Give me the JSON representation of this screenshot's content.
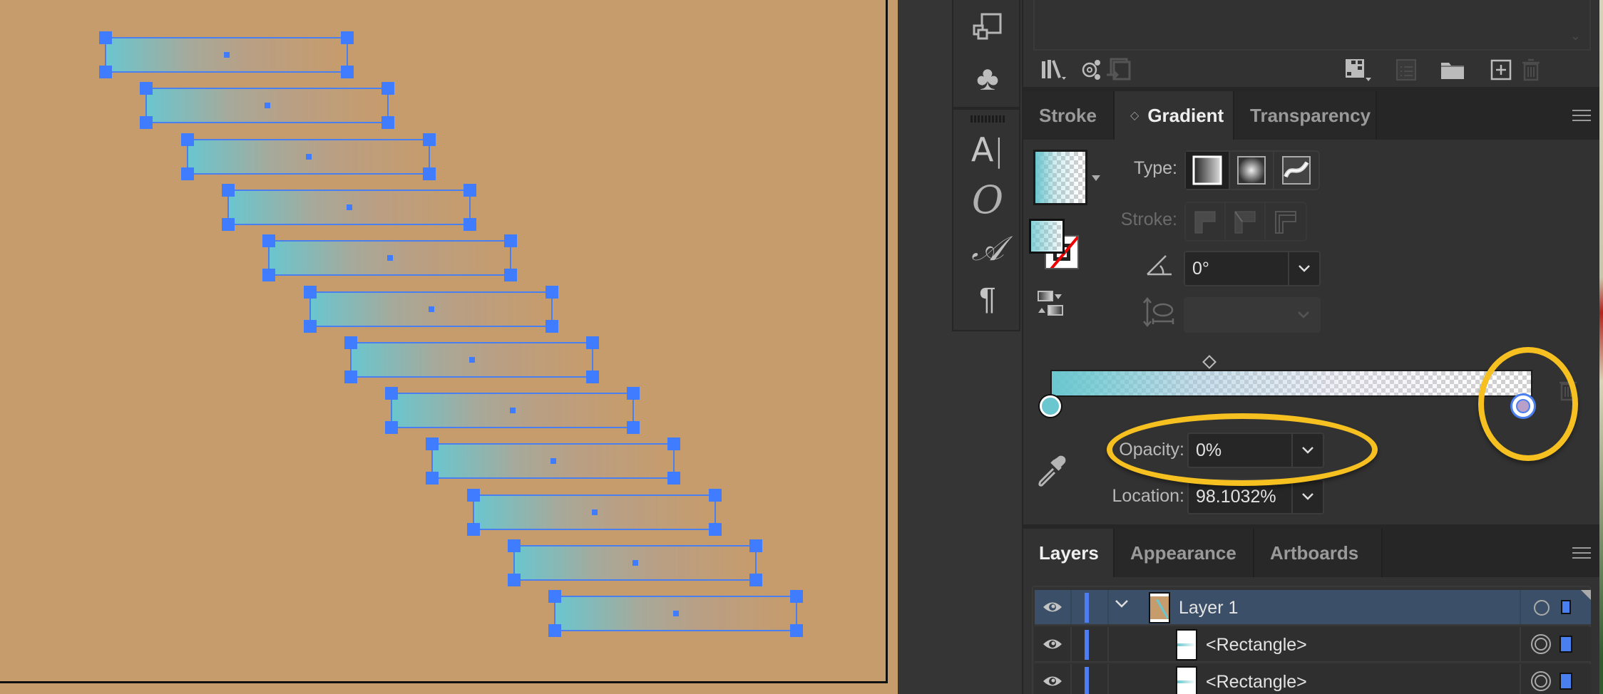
{
  "canvas": {
    "artboard_color": "#c69c6d",
    "selection_color": "#3f7cff",
    "gradient_from": "#6ac6cf",
    "rectangles_count": 12
  },
  "toolstrip": {
    "icons": [
      "artboards-icon",
      "symbols-icon",
      "character-icon",
      "opentype-icon",
      "glyphs-icon",
      "paragraph-icon"
    ]
  },
  "libraries_panel": {
    "icons_left": [
      "libraries-icon",
      "share-icon",
      "place-icon"
    ],
    "icons_right": [
      "grid-view-icon",
      "list-view-icon",
      "folder-icon",
      "new-item-icon",
      "trash-icon"
    ]
  },
  "gradient_panel": {
    "tabs": [
      {
        "label": "Stroke",
        "active": false
      },
      {
        "label": "Gradient",
        "active": true
      },
      {
        "label": "Transparency",
        "active": false
      }
    ],
    "type_label": "Type:",
    "type_options": [
      "Linear",
      "Radial",
      "Freeform"
    ],
    "type_selected": "Linear",
    "stroke_label": "Stroke:",
    "stroke_options": [
      "Within",
      "Along",
      "Across"
    ],
    "angle_value": "0°",
    "aspect_value": "",
    "stops": [
      {
        "color": "#6ac6cf",
        "location": 0,
        "selected": false
      },
      {
        "color": "#b8a0c8",
        "location": 98.1032,
        "selected": true
      }
    ],
    "midpoint_location": 33,
    "opacity_label": "Opacity:",
    "opacity_value": "0%",
    "location_label": "Location:",
    "location_value": "98.1032%"
  },
  "layers_panel": {
    "tabs": [
      {
        "label": "Layers",
        "active": true
      },
      {
        "label": "Appearance",
        "active": false
      },
      {
        "label": "Artboards",
        "active": false
      }
    ],
    "rows": [
      {
        "name": "Layer 1",
        "level": 0,
        "expanded": true,
        "selected": true
      },
      {
        "name": "<Rectangle>",
        "level": 1,
        "selected": false
      },
      {
        "name": "<Rectangle>",
        "level": 1,
        "selected": false
      }
    ]
  }
}
